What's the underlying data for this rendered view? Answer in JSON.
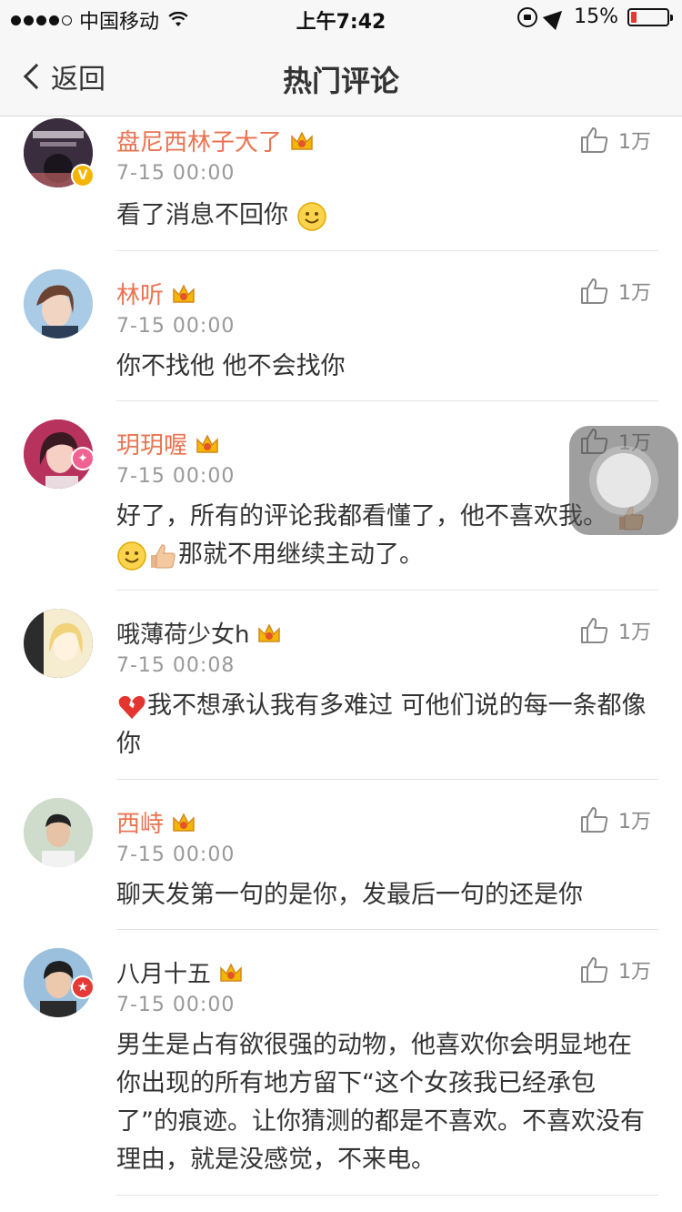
{
  "status_bar": {
    "carrier": "中国移动",
    "time": "上午7:42",
    "battery": "15%",
    "battery_level": 0.15,
    "signal_bars": 4
  },
  "nav": {
    "back_label": "返回",
    "title": "热门评论"
  },
  "colors": {
    "username_highlight": "#eb7350",
    "text": "#333333",
    "meta": "#999999"
  },
  "comments": [
    {
      "username": "盘尼西林子大了",
      "timestamp": "7-15 00:00",
      "text": "看了消息不回你",
      "likes": "1万",
      "badge": "verified-v"
    },
    {
      "username": "林听",
      "timestamp": "7-15 00:00",
      "text": "你不找他 他不会找你",
      "likes": "1万"
    },
    {
      "username": "玥玥喔",
      "timestamp": "7-15 00:00",
      "text_part1": "好了，所有的评论我都看懂了，他不喜欢我。",
      "text_part2": "那就不用继续主动了。",
      "likes": "1万",
      "badge": "pink"
    },
    {
      "username": "哦薄荷少女h",
      "timestamp": "7-15 00:08",
      "text": "我不想承认我有多难过  可他们说的每一条都像你",
      "likes": "1万"
    },
    {
      "username": "西峙",
      "timestamp": "7-15 00:00",
      "text": "聊天发第一句的是你，发最后一句的还是你",
      "likes": "1万"
    },
    {
      "username": "八月十五",
      "timestamp": "7-15 00:00",
      "text": "男生是占有欲很强的动物，他喜欢你会明显地在你出现的所有地方留下“这个女孩我已经承包了”的痕迹。让你猜测的都是不喜欢。不喜欢没有理由，就是没感觉，不来电。",
      "likes": "1万",
      "badge": "red-star"
    }
  ]
}
